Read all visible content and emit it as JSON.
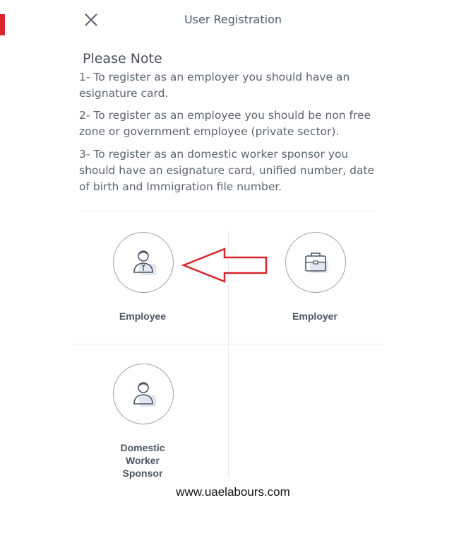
{
  "header": {
    "close_icon": "close-icon",
    "title": "User Registration"
  },
  "note": {
    "title": "Please Note",
    "items": [
      "1- To register as an employer you should have an esignature card.",
      "2- To register as an employee you should be non free zone or government employee (private sector).",
      "3- To register as an domestic worker sponsor you should have an esignature card, unified number, date of birth and Immigration file number."
    ]
  },
  "options": [
    {
      "label": "Employee",
      "icon": "employee-icon"
    },
    {
      "label": "Employer",
      "icon": "briefcase-icon"
    },
    {
      "label": "Domestic\nWorker\nSponsor",
      "icon": "sponsor-icon"
    }
  ],
  "annotation": {
    "icon": "red-arrow-icon",
    "color": "#d9262a"
  },
  "watermark": "www.uaelabours.com"
}
